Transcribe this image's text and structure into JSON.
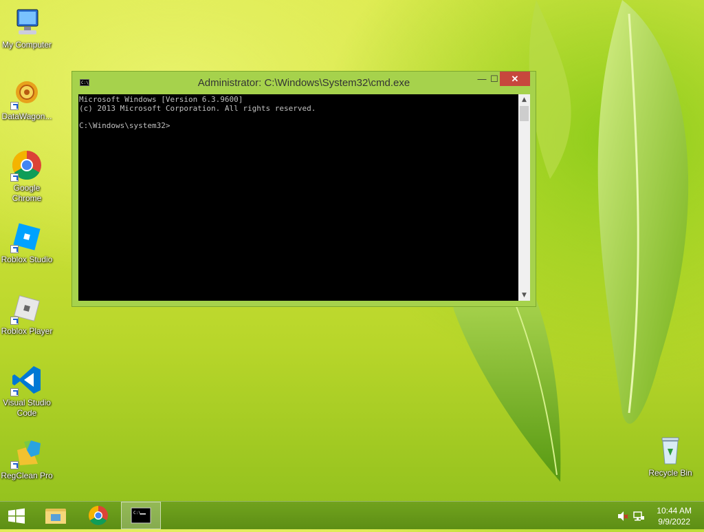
{
  "desktop": {
    "icons": [
      {
        "label": "My Computer",
        "icon": "computer-icon",
        "shortcut": false
      },
      {
        "label": "DataWagon...",
        "icon": "datawagon-icon",
        "shortcut": true
      },
      {
        "label": "Google\nChrome",
        "icon": "chrome-icon",
        "shortcut": true
      },
      {
        "label": "Roblox Studio",
        "icon": "roblox-studio-icon",
        "shortcut": true
      },
      {
        "label": "Roblox Player",
        "icon": "roblox-player-icon",
        "shortcut": true
      },
      {
        "label": "Visual Studio\nCode",
        "icon": "vscode-icon",
        "shortcut": true
      },
      {
        "label": "RegClean Pro",
        "icon": "regclean-icon",
        "shortcut": true
      }
    ],
    "recycle_bin": {
      "label": "Recycle Bin",
      "icon": "recycle-bin-icon"
    }
  },
  "cmd_window": {
    "title": "Administrator: C:\\Windows\\System32\\cmd.exe",
    "system_icon_text": "C:\\",
    "minimize": "—",
    "maximize": "☐",
    "close": "✕",
    "console_text": "Microsoft Windows [Version 6.3.9600]\n(c) 2013 Microsoft Corporation. All rights reserved.\n\nC:\\Windows\\system32>"
  },
  "taskbar": {
    "items": [
      {
        "name": "start-button",
        "icon": "windows-logo-icon"
      },
      {
        "name": "file-explorer",
        "icon": "folder-icon"
      },
      {
        "name": "chrome",
        "icon": "chrome-icon"
      },
      {
        "name": "cmd",
        "icon": "cmd-icon",
        "active": true
      }
    ],
    "tray": {
      "volume_icon": "speaker-muted-icon",
      "network_icon": "network-icon",
      "time": "10:44 AM",
      "date": "9/9/2022"
    }
  },
  "colors": {
    "window_frame": "#a6d24c",
    "close_button": "#c7473d",
    "console_bg": "#000000",
    "console_text": "#c0c0c0"
  }
}
